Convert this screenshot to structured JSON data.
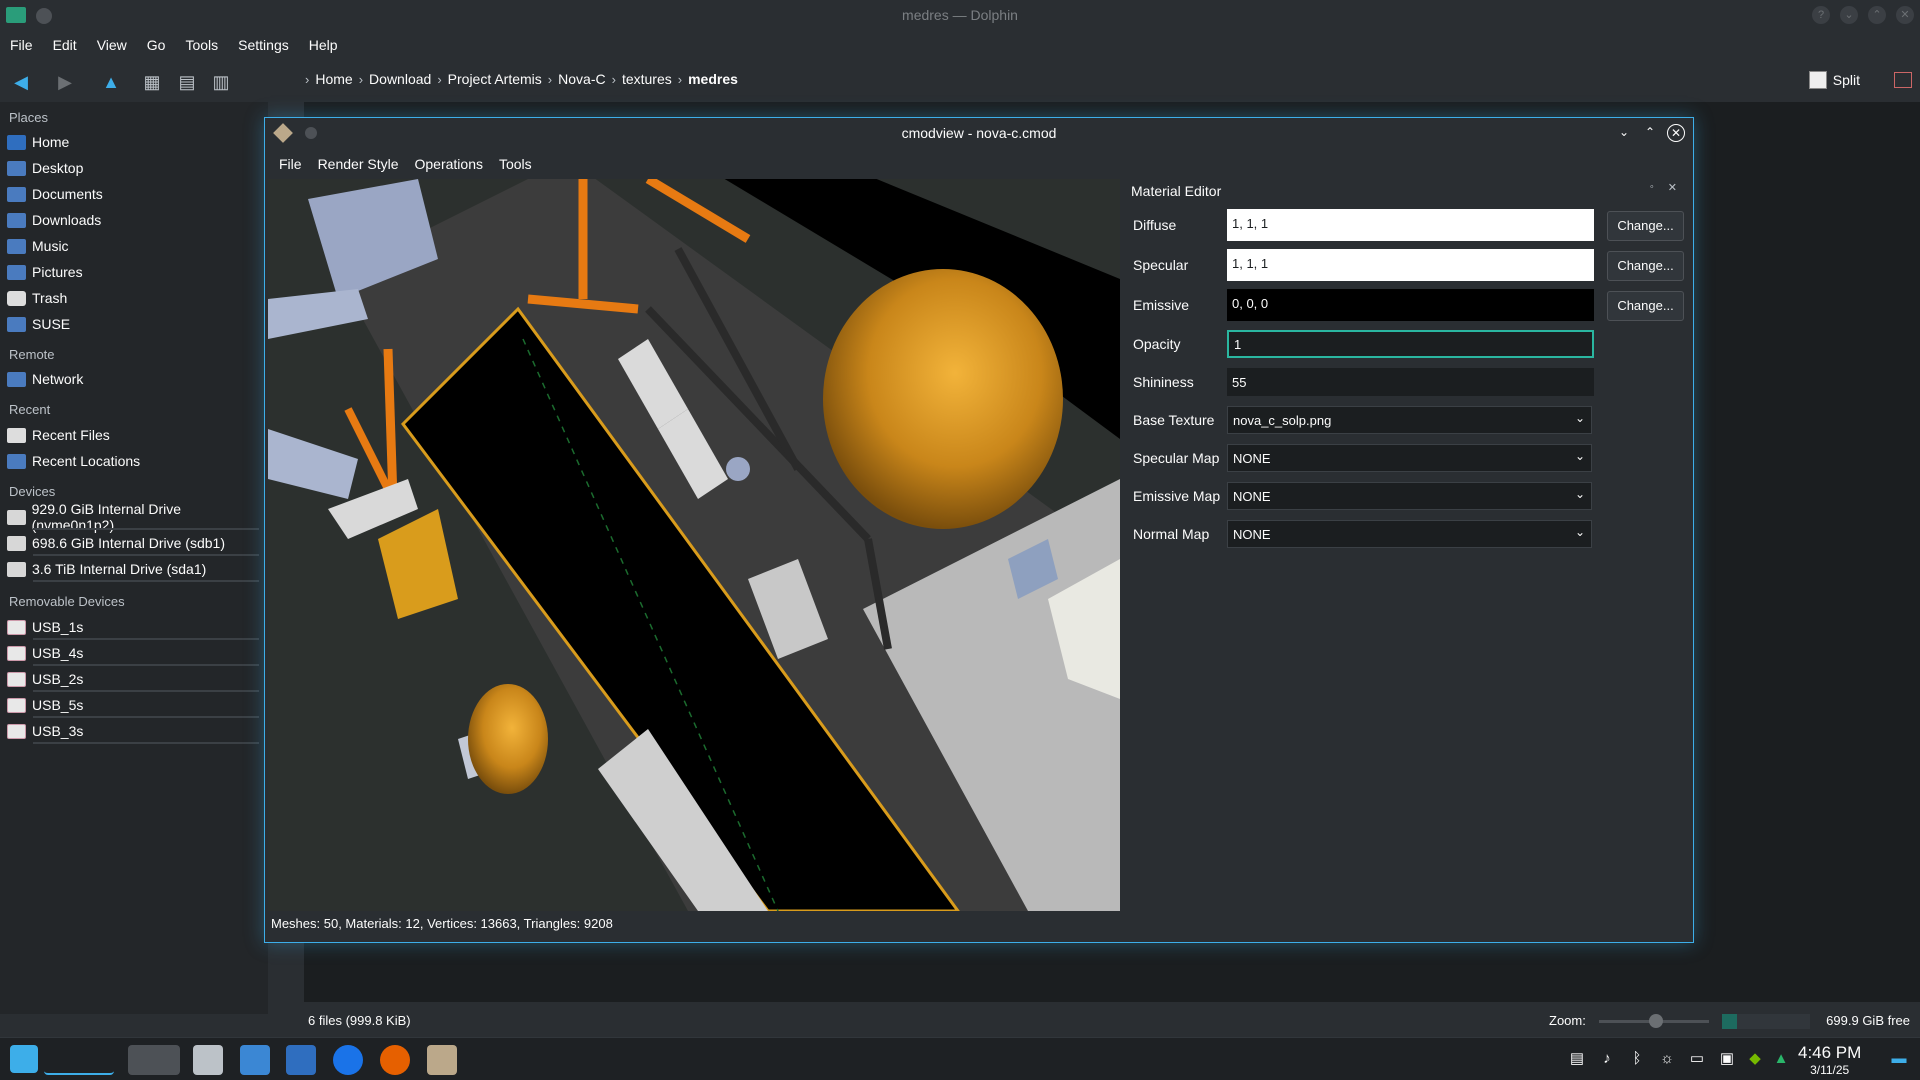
{
  "window": {
    "title": "medres — Dolphin"
  },
  "menubar": [
    "File",
    "Edit",
    "View",
    "Go",
    "Tools",
    "Settings",
    "Help"
  ],
  "breadcrumb": {
    "items": [
      "Home",
      "Download",
      "Project Artemis",
      "Nova-C",
      "textures"
    ],
    "current": "medres"
  },
  "toolbar": {
    "split_label": "Split"
  },
  "places": {
    "places_title": "Places",
    "places_items": [
      "Home",
      "Desktop",
      "Documents",
      "Downloads",
      "Music",
      "Pictures",
      "Trash",
      "SUSE"
    ],
    "remote_title": "Remote",
    "remote_items": [
      "Network"
    ],
    "recent_title": "Recent",
    "recent_items": [
      "Recent Files",
      "Recent Locations"
    ],
    "devices_title": "Devices",
    "devices_items": [
      "929.0 GiB Internal Drive (nvme0n1p2)",
      "698.6 GiB Internal Drive (sdb1)",
      "3.6 TiB Internal Drive (sda1)"
    ],
    "removable_title": "Removable Devices",
    "removable_items": [
      "USB_1s",
      "USB_4s",
      "USB_2s",
      "USB_5s",
      "USB_3s"
    ]
  },
  "statusbar": {
    "files": "6 files (999.8 KiB)",
    "zoom_label": "Zoom:",
    "free": "699.9 GiB free"
  },
  "cmodview": {
    "title": "cmodview - nova-c.cmod",
    "menu": [
      "File",
      "Render Style",
      "Operations",
      "Tools"
    ],
    "status": "Meshes: 50, Materials: 12, Vertices: 13663, Triangles: 9208"
  },
  "material_editor": {
    "title": "Material Editor",
    "diffuse_label": "Diffuse",
    "diffuse_value": "1, 1, 1",
    "specular_label": "Specular",
    "specular_value": "1, 1, 1",
    "emissive_label": "Emissive",
    "emissive_value": "0, 0, 0",
    "change_label": "Change...",
    "opacity_label": "Opacity",
    "opacity_value": "1",
    "shininess_label": "Shininess",
    "shininess_value": "55",
    "base_texture_label": "Base Texture",
    "base_texture_value": "nova_c_solp.png",
    "specular_map_label": "Specular Map",
    "specular_map_value": "NONE",
    "emissive_map_label": "Emissive Map",
    "emissive_map_value": "NONE",
    "normal_map_label": "Normal Map",
    "normal_map_value": "NONE"
  },
  "clock": {
    "time": "4:46 PM",
    "date": "3/11/25"
  },
  "colors": {
    "accent": "#3daee9",
    "focus": "#2ab6a0",
    "gold": "#d99c1c",
    "orange": "#e77a12"
  }
}
